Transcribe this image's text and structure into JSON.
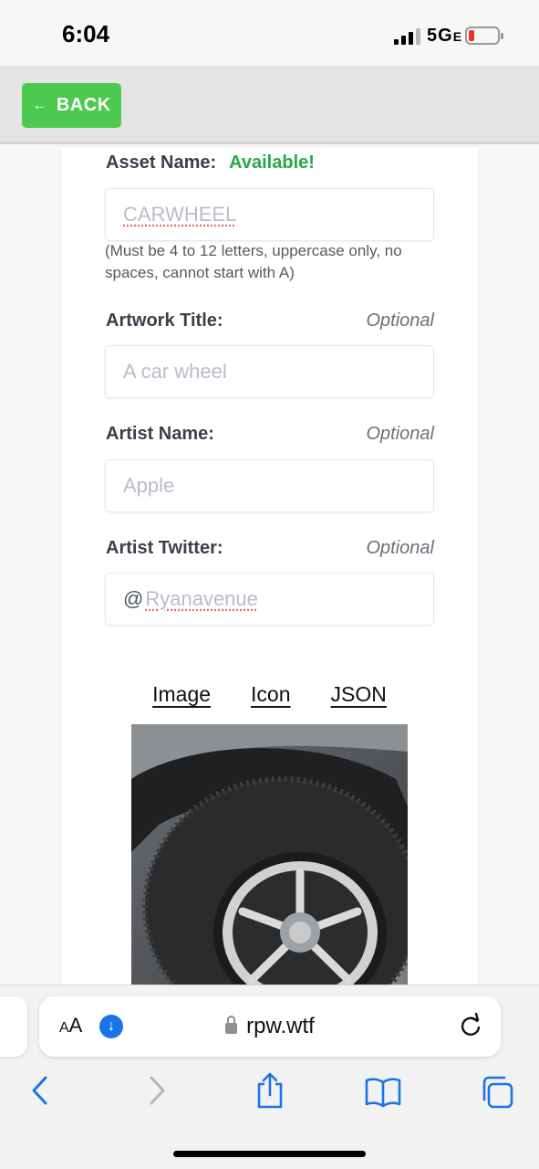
{
  "status": {
    "time": "6:04",
    "network": "5G",
    "network_suffix": "E"
  },
  "header": {
    "back_label": "BACK"
  },
  "form": {
    "asset_name": {
      "label": "Asset Name:",
      "availability": "Available!",
      "placeholder": "CARWHEEL",
      "hint": "(Must be 4 to 12 letters, uppercase only, no spaces, cannot start with A)"
    },
    "artwork_title": {
      "label": "Artwork Title:",
      "optional": "Optional",
      "placeholder": "A car wheel"
    },
    "artist_name": {
      "label": "Artist Name:",
      "optional": "Optional",
      "placeholder": "Apple"
    },
    "artist_twitter": {
      "label": "Artist Twitter:",
      "optional": "Optional",
      "prefix": "@",
      "placeholder": "Ryanavenue"
    }
  },
  "media_tabs": [
    "Image",
    "Icon",
    "JSON"
  ],
  "browser": {
    "aa_small": "A",
    "aa_large": "A",
    "url": "rpw.wtf"
  },
  "colors": {
    "accent_green": "#4cc94f",
    "available_green": "#2aa846",
    "link_blue": "#1a74e8"
  }
}
